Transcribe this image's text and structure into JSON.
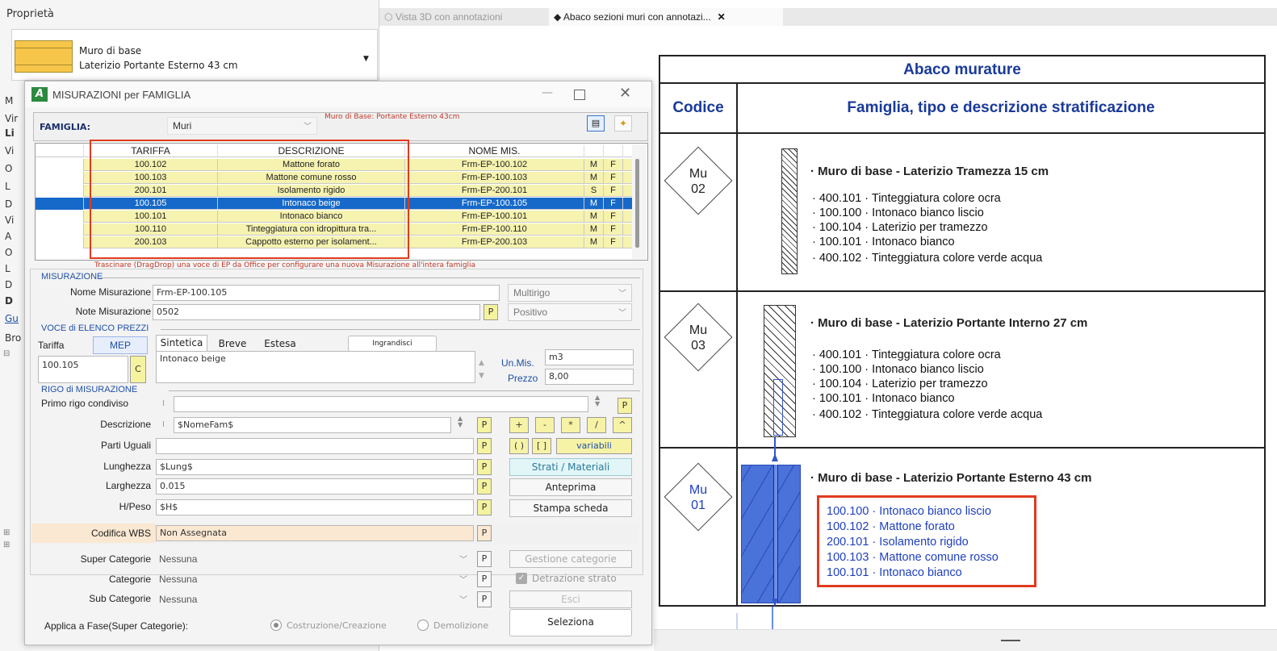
{
  "properties": {
    "title": "Proprietà",
    "type_line1": "Muro di base",
    "type_line2": "Laterizio Portante Esterno 43 cm",
    "side_labels": [
      "M",
      "Vir",
      "Li",
      "Vi",
      "O",
      "L",
      "D",
      "Vi",
      "A",
      "O",
      "L",
      "D",
      "D",
      "Gu",
      "Bro"
    ]
  },
  "tabs": [
    {
      "label": "Vista 3D con annotazioni"
    },
    {
      "label": "Abaco sezioni muri con annotazi...",
      "close": "✕"
    }
  ],
  "dialog": {
    "logo": "A",
    "title": "MISURAZIONI per FAMIGLIA",
    "famiglia_label": "FAMIGLIA:",
    "famiglia_value": "Muri",
    "header_note": "Muro di Base: Portante Esterno 43cm",
    "grid": {
      "headers": [
        "TARIFFA",
        "DESCRIZIONE",
        "NOME MIS.",
        "",
        ""
      ],
      "rows": [
        {
          "tariffa": "100.102",
          "descrizione": "Mattone forato",
          "nome": "Frm-EP-100.102",
          "m": "M",
          "f": "F",
          "selected": false
        },
        {
          "tariffa": "100.103",
          "descrizione": "Mattone comune rosso",
          "nome": "Frm-EP-100.103",
          "m": "M",
          "f": "F",
          "selected": false
        },
        {
          "tariffa": "200.101",
          "descrizione": "Isolamento rigido",
          "nome": "Frm-EP-200.101",
          "m": "S",
          "f": "F",
          "selected": false
        },
        {
          "tariffa": "100.105",
          "descrizione": "Intonaco beige",
          "nome": "Frm-EP-100.105",
          "m": "M",
          "f": "F",
          "selected": true
        },
        {
          "tariffa": "100.101",
          "descrizione": "Intonaco bianco",
          "nome": "Frm-EP-100.101",
          "m": "M",
          "f": "F",
          "selected": false
        },
        {
          "tariffa": "100.110",
          "descrizione": "Tinteggiatura con idropittura tra...",
          "nome": "Frm-EP-100.110",
          "m": "M",
          "f": "F",
          "selected": false
        },
        {
          "tariffa": "200.103",
          "descrizione": "Cappotto esterno per isolament...",
          "nome": "Frm-EP-200.103",
          "m": "M",
          "f": "F",
          "selected": false
        }
      ]
    },
    "drag_hint": "Trascinare (DragDrop) una voce di EP da Office per configurare una nuova Misurazione all'intera famiglia",
    "misurazione": {
      "section": "MISURAZIONE",
      "nome_label": "Nome Misurazione",
      "nome_value": "Frm-EP-100.105",
      "multirigo": "Multirigo",
      "note_label": "Note Misurazione",
      "note_value": "0502",
      "p": "P",
      "positivo": "Positivo"
    },
    "voce": {
      "section": "VOCE di ELENCO PREZZI",
      "tariffa_label": "Tariffa",
      "mep": "MEP",
      "tab_sintetica": "Sintetica",
      "tab_breve": "Breve",
      "tab_estesa": "Estesa",
      "ingrandisci": "Ingrandisci",
      "tariffa_value": "100.105",
      "c": "C",
      "desc_value": "Intonaco beige",
      "unmis_label": "Un.Mis.",
      "unmis_value": "m3",
      "prezzo_label": "Prezzo",
      "prezzo_value": "8,00"
    },
    "rigo": {
      "section": "RIGO di MISURAZIONE",
      "primo_label": "Primo rigo condiviso",
      "i": "I",
      "descrizione_label": "Descrizione",
      "descrizione_value": "$NomeFam$",
      "parti_label": "Parti Uguali",
      "lunghezza_label": "Lunghezza",
      "lunghezza_value": "$Lung$",
      "larghezza_label": "Larghezza",
      "larghezza_value": "0.015",
      "hpeso_label": "H/Peso",
      "hpeso_value": "$H$",
      "ops": [
        "+",
        "-",
        "*",
        "/",
        "^"
      ],
      "paren": "( )",
      "brackets": "[ ]",
      "variabili": "variabili",
      "strati": "Strati / Materiali",
      "anteprima": "Anteprima",
      "stampa": "Stampa scheda"
    },
    "wbs": {
      "label": "Codifica WBS",
      "value": "Non Assegnata"
    },
    "categorie": {
      "super_label": "Super Categorie",
      "super_value": "Nessuna",
      "cat_label": "Categorie",
      "cat_value": "Nessuna",
      "sub_label": "Sub Categorie",
      "sub_value": "Nessuna",
      "gestione": "Gestione categorie",
      "detrazione": "Detrazione strato",
      "esci": "Esci"
    },
    "fase": {
      "label": "Applica a Fase(Super Categorie):",
      "opt1": "Costruzione/Creazione",
      "opt2": "Demolizione",
      "seleziona": "Seleziona"
    }
  },
  "schedule": {
    "title": "Abaco murature",
    "col_codice": "Codice",
    "col_famiglia": "Famiglia, tipo e descrizione stratificazione",
    "entries": [
      {
        "code_line1": "Mu",
        "code_line2": "02",
        "title": "· Muro di base -  Laterizio Tramezza 15 cm",
        "lines": [
          "· 400.101 · Tinteggiatura colore ocra",
          "· 100.100 · Intonaco bianco liscio",
          "· 100.104 · Laterizio per tramezzo",
          "· 100.101 · Intonaco bianco",
          "· 400.102 · Tinteggiatura colore verde acqua"
        ]
      },
      {
        "code_line1": "Mu",
        "code_line2": "03",
        "title": "· Muro di base -  Laterizio Portante Interno 27 cm",
        "lines": [
          "· 400.101 · Tinteggiatura colore ocra",
          "· 100.100 · Intonaco bianco liscio",
          "· 100.104 · Laterizio per tramezzo",
          "· 100.101 · Intonaco bianco",
          "· 400.102 · Tinteggiatura colore verde acqua"
        ]
      },
      {
        "code_line1": "Mu",
        "code_line2": "01",
        "title": "· Muro di base -  Laterizio Portante Esterno 43 cm",
        "lines": [
          "100.100 · Intonaco bianco liscio",
          "100.102 · Mattone forato",
          "200.101 · Isolamento rigido",
          "100.103 · Mattone comune rosso",
          "100.101 · Intonaco bianco"
        ]
      }
    ]
  },
  "colors": {
    "highlight_red": "#e03a1e",
    "selection_blue": "#1669c8",
    "yellow_row": "#f6f3b0"
  }
}
